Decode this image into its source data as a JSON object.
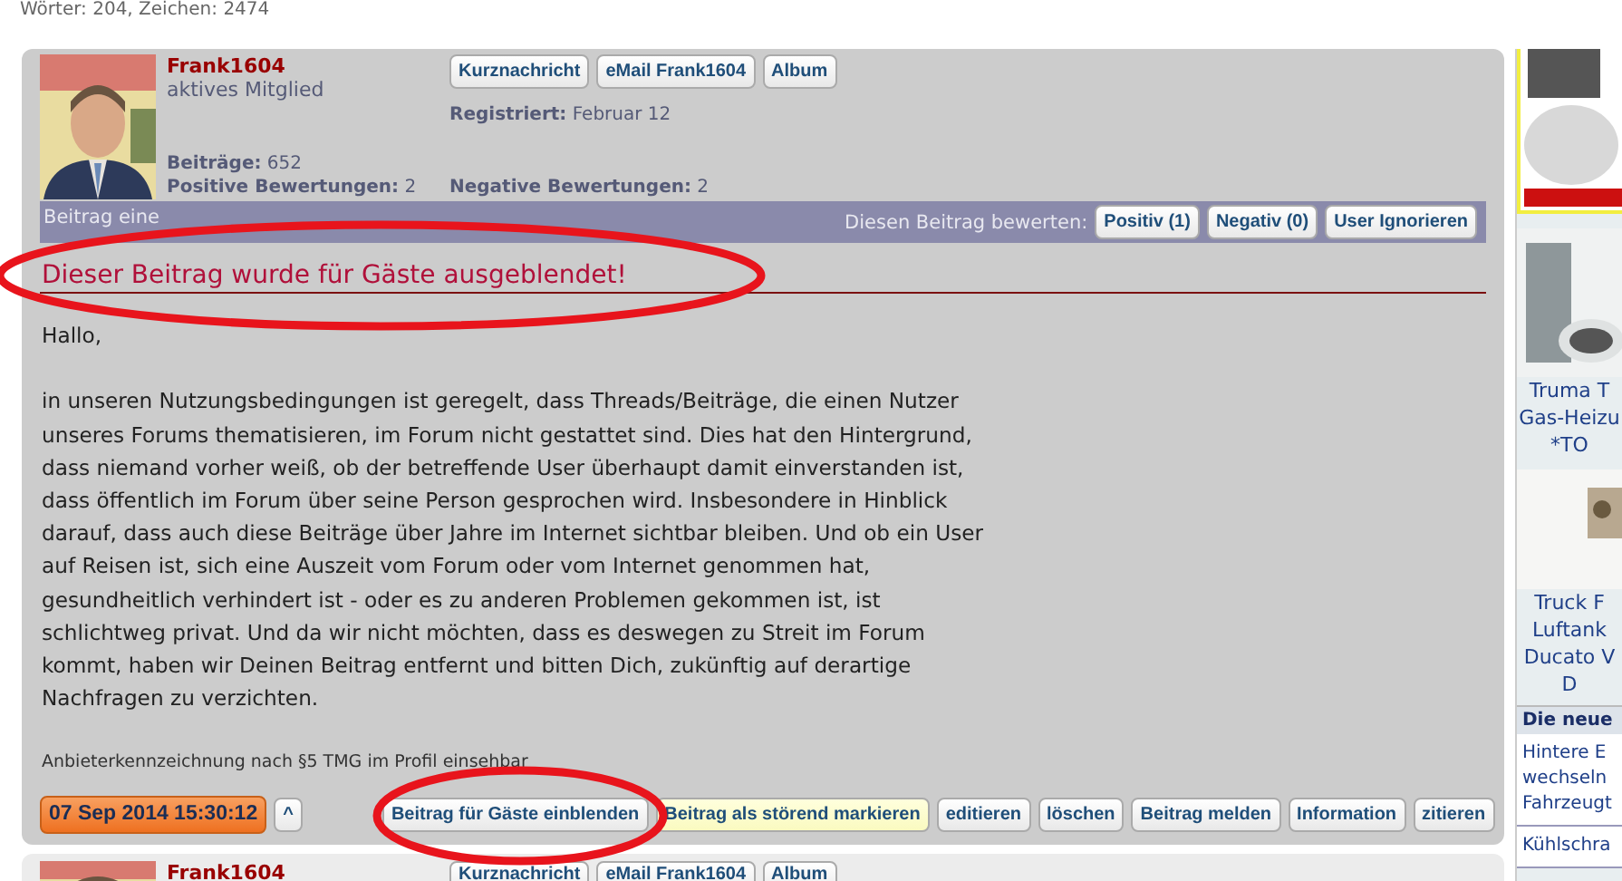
{
  "top_info": "Wörter: 204, Zeichen: 2474",
  "post": {
    "author": "Frank1604",
    "rank": "aktives Mitglied",
    "profile_buttons": [
      "Kurznachricht",
      "eMail Frank1604",
      "Album"
    ],
    "registered_label": "Registriert:",
    "registered_value": "Februar 12",
    "stats": [
      {
        "label": "Beiträge:",
        "value": "652"
      },
      {
        "label": "Positive Bewertungen:",
        "value": "2"
      },
      {
        "label": "Negative Bewertungen:",
        "value": "2"
      }
    ],
    "bar_text": "Beitrag eine",
    "rate_label": "Diesen Beitrag bewerten:",
    "rate_buttons": [
      "Positiv (1)",
      "Negativ (0)",
      "User Ignorieren"
    ],
    "notice": "Dieser Beitrag wurde für Gäste ausgeblendet!",
    "greeting": "Hallo,",
    "body": "in unseren Nutzungsbedingungen ist geregelt, dass Threads/Beiträge, die einen Nutzer unseres Forums thematisieren, im Forum nicht gestattet sind. Dies hat den Hintergrund, dass niemand vorher weiß, ob der betreffende User überhaupt damit einverstanden ist, dass öffentlich im Forum über seine Person gesprochen wird. Insbesondere in Hinblick darauf, dass auch diese Beiträge über Jahre im Internet sichtbar bleiben. Und ob ein User auf Reisen ist, sich eine Auszeit vom Forum oder vom Internet genommen hat, gesundheitlich verhindert ist - oder es zu anderen Problemen gekommen ist, ist schlichtweg privat. Und da wir nicht möchten, dass es deswegen zu Streit im Forum kommt, haben wir Deinen Beitrag entfernt und bitten Dich, zukünftig auf derartige Nachfragen zu verzichten.",
    "signature": "Anbieterkennzeichnung nach §5 TMG im Profil einsehbar",
    "date": "07 Sep 2014 15:30:12",
    "up_button": "^",
    "actions": [
      {
        "label": "Beitrag für Gäste einblenden",
        "kind": "normal"
      },
      {
        "label": "Beitrag als störend markieren",
        "kind": "highlight"
      },
      {
        "label": "editieren",
        "kind": "normal"
      },
      {
        "label": "löschen",
        "kind": "normal"
      },
      {
        "label": "Beitrag melden",
        "kind": "normal"
      },
      {
        "label": "Information",
        "kind": "normal"
      },
      {
        "label": "zitieren",
        "kind": "normal"
      }
    ]
  },
  "next_post": {
    "author": "Frank1604",
    "profile_buttons": [
      "Kurznachricht",
      "eMail Frank1604",
      "Album"
    ]
  },
  "sidebar": {
    "ads": [
      {
        "lines": [
          "Truma T",
          "Gas-Heizu",
          "*TO"
        ]
      },
      {
        "lines": [
          "Truck F",
          "Luftank",
          "Ducato V",
          "D"
        ]
      }
    ],
    "heading": "Die neue",
    "topics": [
      {
        "lines": [
          "Hintere E",
          "wechseln",
          "Fahrzeugt"
        ]
      },
      {
        "lines": [
          "Kühlschra"
        ]
      }
    ]
  },
  "annotations": [
    {
      "kind": "ellipse"
    },
    {
      "kind": "ellipse"
    }
  ]
}
